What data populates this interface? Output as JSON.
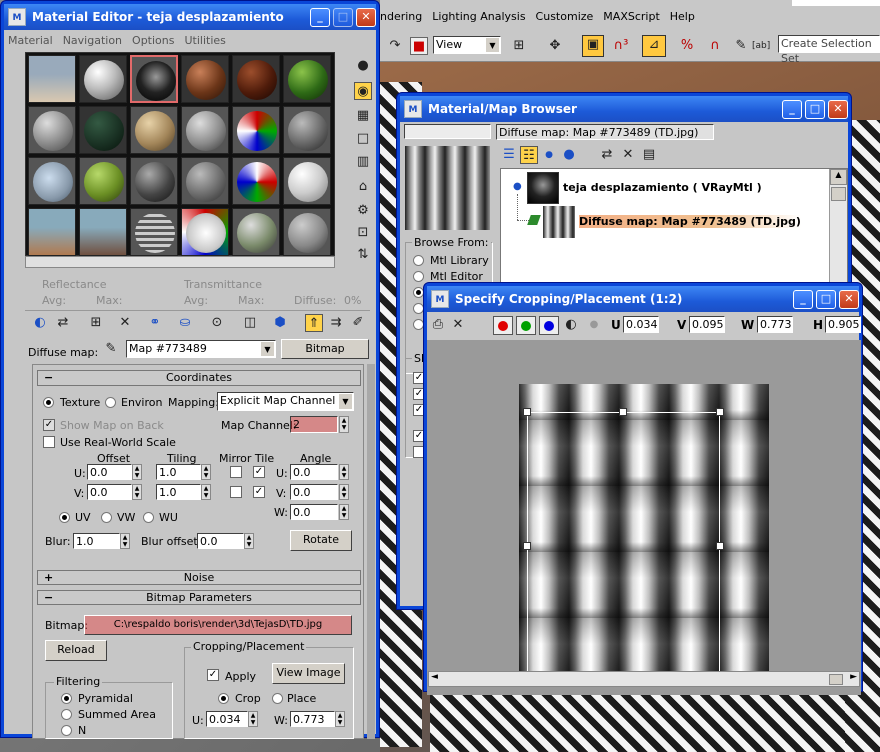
{
  "max_menu": [
    "ndering",
    "Lighting Analysis",
    "Customize",
    "MAXScript",
    "Help"
  ],
  "max_toolbar": {
    "view_select": "View",
    "selection_set": "Create Selection Set"
  },
  "mat_editor": {
    "title": "Material Editor - teja desplazamiento",
    "menu": [
      "Material",
      "Navigation",
      "Options",
      "Utilities"
    ],
    "reflectance": "Reflectance",
    "transmittance": "Transmittance",
    "avg": "Avg:",
    "max": "Max:",
    "diffuse": "Diffuse:",
    "diffuse_pct": "0%",
    "diffuse_map_label": "Diffuse map:",
    "map_name": "Map #773489",
    "map_type": "Bitmap",
    "coordinates": {
      "header": "Coordinates",
      "texture": "Texture",
      "environ": "Environ",
      "mapping_label": "Mapping:",
      "mapping_value": "Explicit Map Channel",
      "show_map": "Show Map on Back",
      "map_channel_label": "Map Channel:",
      "map_channel": "2",
      "real_world": "Use Real-World Scale",
      "offset": "Offset",
      "tiling": "Tiling",
      "mirror_tile": "Mirror Tile",
      "angle": "Angle",
      "u": "U:",
      "v": "V:",
      "w": "W:",
      "offset_u": "0.0",
      "offset_v": "0.0",
      "tiling_u": "1.0",
      "tiling_v": "1.0",
      "angle_u": "0.0",
      "angle_v": "0.0",
      "angle_w": "0.0",
      "uv": "UV",
      "vw": "VW",
      "wu": "WU",
      "blur": "Blur:",
      "blur_val": "1.0",
      "blur_offset": "Blur offset:",
      "blur_offset_val": "0.0",
      "rotate": "Rotate"
    },
    "noise": "Noise",
    "bitmap_params": {
      "header": "Bitmap Parameters",
      "bitmap_label": "Bitmap:",
      "path": "C:\\respaldo boris\\render\\3d\\TejasD\\TD.jpg",
      "reload": "Reload",
      "cropping": "Cropping/Placement",
      "apply": "Apply",
      "view_image": "View Image",
      "crop": "Crop",
      "place": "Place",
      "u": "U:",
      "w": "W:",
      "u_val": "0.034",
      "w_val": "0.773",
      "filtering": "Filtering",
      "pyramidal": "Pyramidal",
      "summed_area": "Summed Area",
      "none": "N"
    }
  },
  "browser": {
    "title": "Material/Map Browser",
    "current": "Diffuse map: Map #773489 (TD.jpg)",
    "browse_from": "Browse From:",
    "mtl_library": "Mtl Library",
    "mtl_editor": "Mtl Editor",
    "show": "Sh",
    "tree_root": "teja desplazamiento  ( VRayMtl )",
    "tree_child": "Diffuse map: Map #773489 (TD.jpg)"
  },
  "crop": {
    "title": "Specify Cropping/Placement (1:2)",
    "u_label": "U",
    "u": "0.034",
    "v_label": "V",
    "v": "0.095",
    "w_label": "W",
    "w": "0.773",
    "h_label": "H",
    "h": "0.905",
    "colors": {
      "red": "#e00000",
      "green": "#00a000",
      "blue": "#0000e0"
    }
  }
}
